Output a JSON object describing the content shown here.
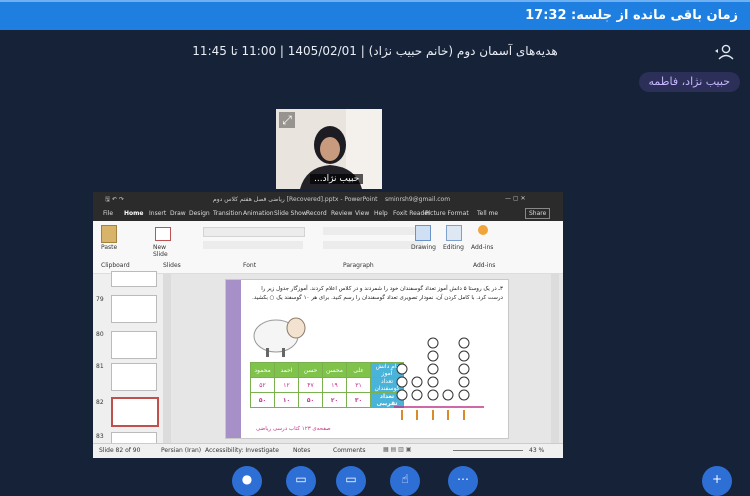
{
  "header": {
    "timer_text": "زمان باقی مانده از جلسه: 17:32"
  },
  "session": {
    "info": "هدیه‌های آسمان دوم (خانم حبیب نژاد) | 1405/02/01 | 11:00 تا 11:45"
  },
  "participant": {
    "name": "حبیب نژاد، فاطمه"
  },
  "webcam": {
    "label": "حبیب نژاد..."
  },
  "ppt": {
    "window_title": "ریاضی فصل هفتم کلاس دوم [Recovered].pptx - PowerPoint",
    "account": "sminrsh9@gmail.com",
    "tabs": [
      "File",
      "Home",
      "Insert",
      "Draw",
      "Design",
      "Transition",
      "Animation",
      "Slide Show",
      "Record",
      "Review",
      "View",
      "Help",
      "Foxit Reader",
      "Picture Format",
      "Tell me",
      "Share"
    ],
    "ribbon_groups": [
      "Clipboard",
      "Slides",
      "Font",
      "Paragraph",
      "Add-ins"
    ],
    "ribbon_buttons": {
      "paste": "Paste",
      "new_slide": "New Slide",
      "drawing": "Drawing",
      "editing": "Editing",
      "addins": "Add-ins"
    },
    "thumb_numbers": [
      "79",
      "80",
      "81",
      "82",
      "83"
    ],
    "slide": {
      "question": "۳ـ در یک روستا ۵ دانش آموز تعداد گوسفندان خود را شمردند و در کلاس اعلام کردند. آموزگار جدول زیر را درست کرد. با کامل کردن آن، نمودار تصویری تعداد گوسفندان را رسم کنید. برای هر ۱۰ گوسفند یک ○ بکشید.",
      "table_header": [
        "نام دانش آموز",
        "علی",
        "محسن",
        "حسن",
        "احمد",
        "محمود"
      ],
      "table_row1": [
        "تعداد گوسفندان",
        "۳۱",
        "۱۹",
        "۴۷",
        "۱۲",
        "۵۲"
      ],
      "table_row2": [
        "تعداد تقریبی",
        "۳۰",
        "۲۰",
        "۵۰",
        "۱۰",
        "۵۰"
      ],
      "footer": "صفحه‌ی ۱۲۳ کتاب درسی ریاضی"
    },
    "status": {
      "slide_info": "Slide 82 of 90",
      "language": "Persian (Iran)",
      "accessibility": "Accessibility: Investigate",
      "notes": "Notes",
      "comments": "Comments",
      "zoom": "43 %"
    }
  },
  "colors": {
    "accent": "#1f7fe0",
    "background": "#152237",
    "button": "#2e6fd6"
  }
}
